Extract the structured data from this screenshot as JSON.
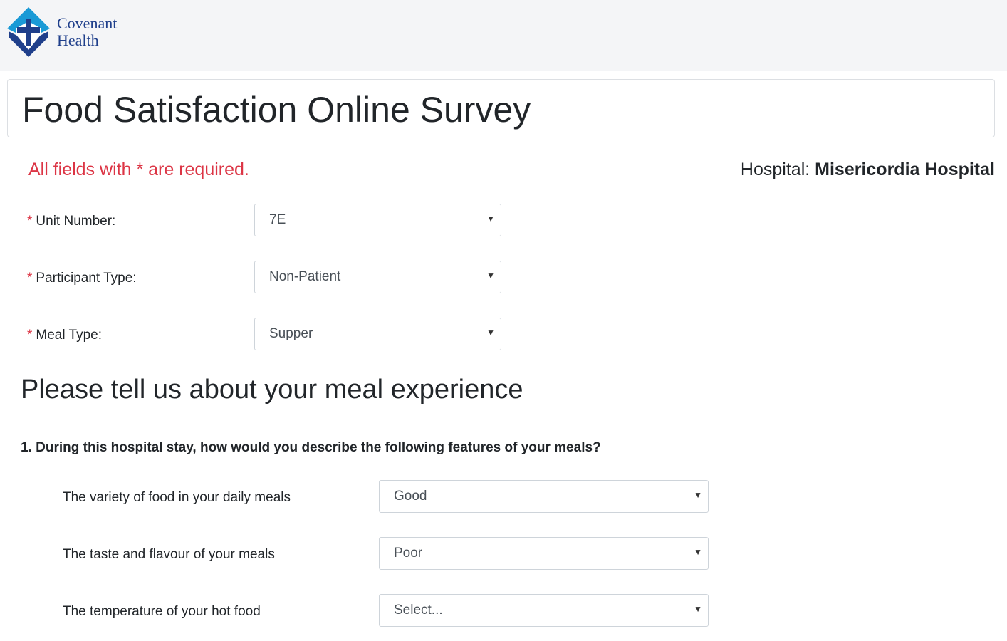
{
  "header": {
    "logo_line1": "Covenant",
    "logo_line2": "Health"
  },
  "page": {
    "title": "Food Satisfaction Online Survey",
    "required_note": "All fields with * are required.",
    "hospital_label": "Hospital:",
    "hospital_name": "Misericordia Hospital"
  },
  "fields": {
    "required_marker": "*",
    "unit_number": {
      "label": "Unit Number:",
      "value": "7E"
    },
    "participant_type": {
      "label": "Participant Type:",
      "value": "Non-Patient"
    },
    "meal_type": {
      "label": "Meal Type:",
      "value": "Supper"
    }
  },
  "section": {
    "heading": "Please tell us about your meal experience",
    "question1": "1. During this hospital stay, how would you describe the following features of your meals?"
  },
  "features": [
    {
      "label": "The variety of food in your daily meals",
      "value": "Good"
    },
    {
      "label": "The taste and flavour of your meals",
      "value": "Poor"
    },
    {
      "label": "The temperature of your hot food",
      "value": "Select..."
    }
  ],
  "icons": {
    "logo": "covenant-cross-icon",
    "dropdown": "caret-down-icon"
  },
  "colors": {
    "brand_blue": "#1f3f8b",
    "brand_teal": "#1a9ad6",
    "required_red": "#dc3545"
  }
}
